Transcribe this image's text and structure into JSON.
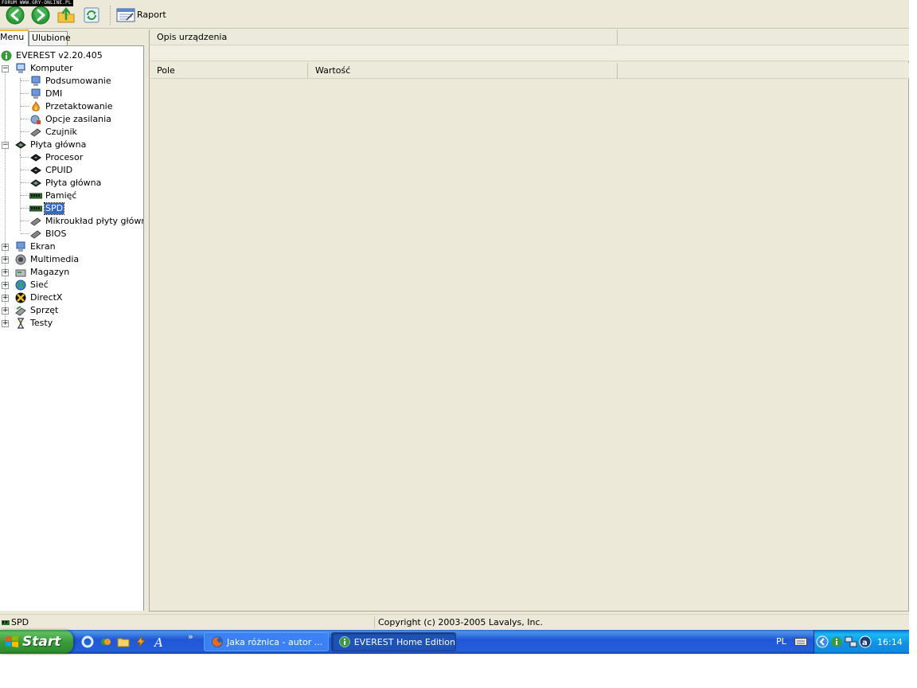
{
  "watermark": "FORUM WWW.GRY-ONLINE.PL",
  "toolbar": {
    "back_icon": "back-arrow-icon",
    "forward_icon": "forward-arrow-icon",
    "up_icon": "folder-up-icon",
    "refresh_icon": "refresh-icon",
    "report_label": "Raport"
  },
  "tabs": [
    {
      "label": "Menu",
      "active": true
    },
    {
      "label": "Ulubione",
      "active": false
    }
  ],
  "tree": {
    "root": "EVEREST v2.20.405",
    "computer": {
      "label": "Komputer",
      "children": [
        "Podsumowanie",
        "DMI",
        "Przetaktowanie",
        "Opcje zasilania",
        "Czujnik"
      ]
    },
    "motherboard": {
      "label": "Płyta główna",
      "children": [
        "Procesor",
        "CPUID",
        "Płyta główna",
        "Pamięć",
        "SPD",
        "Mikroukład płyty głównej",
        "BIOS"
      ],
      "selected": "SPD"
    },
    "collapsed": [
      "Ekran",
      "Multimedia",
      "Magazyn",
      "Sieć",
      "DirectX",
      "Sprzęt",
      "Testy"
    ]
  },
  "right_panel": {
    "desc_header": "Opis urządzenia",
    "col_field": "Pole",
    "col_value": "Wartość"
  },
  "statusbar": {
    "left": "SPD",
    "center": "Copyright (c) 2003-2005 Lavalys, Inc."
  },
  "taskbar": {
    "start_label": "Start",
    "more": "»",
    "tasks": [
      {
        "label": "Jaka różnica - autor ...",
        "active": false
      },
      {
        "label": "EVEREST Home Edition",
        "active": true
      }
    ],
    "language": "PL",
    "clock": "16:14"
  },
  "colors": {
    "window_bg": "#ece9d8",
    "selection": "#316ac5",
    "taskbar_blue": "#245edb",
    "start_green": "#3a9b3a"
  }
}
